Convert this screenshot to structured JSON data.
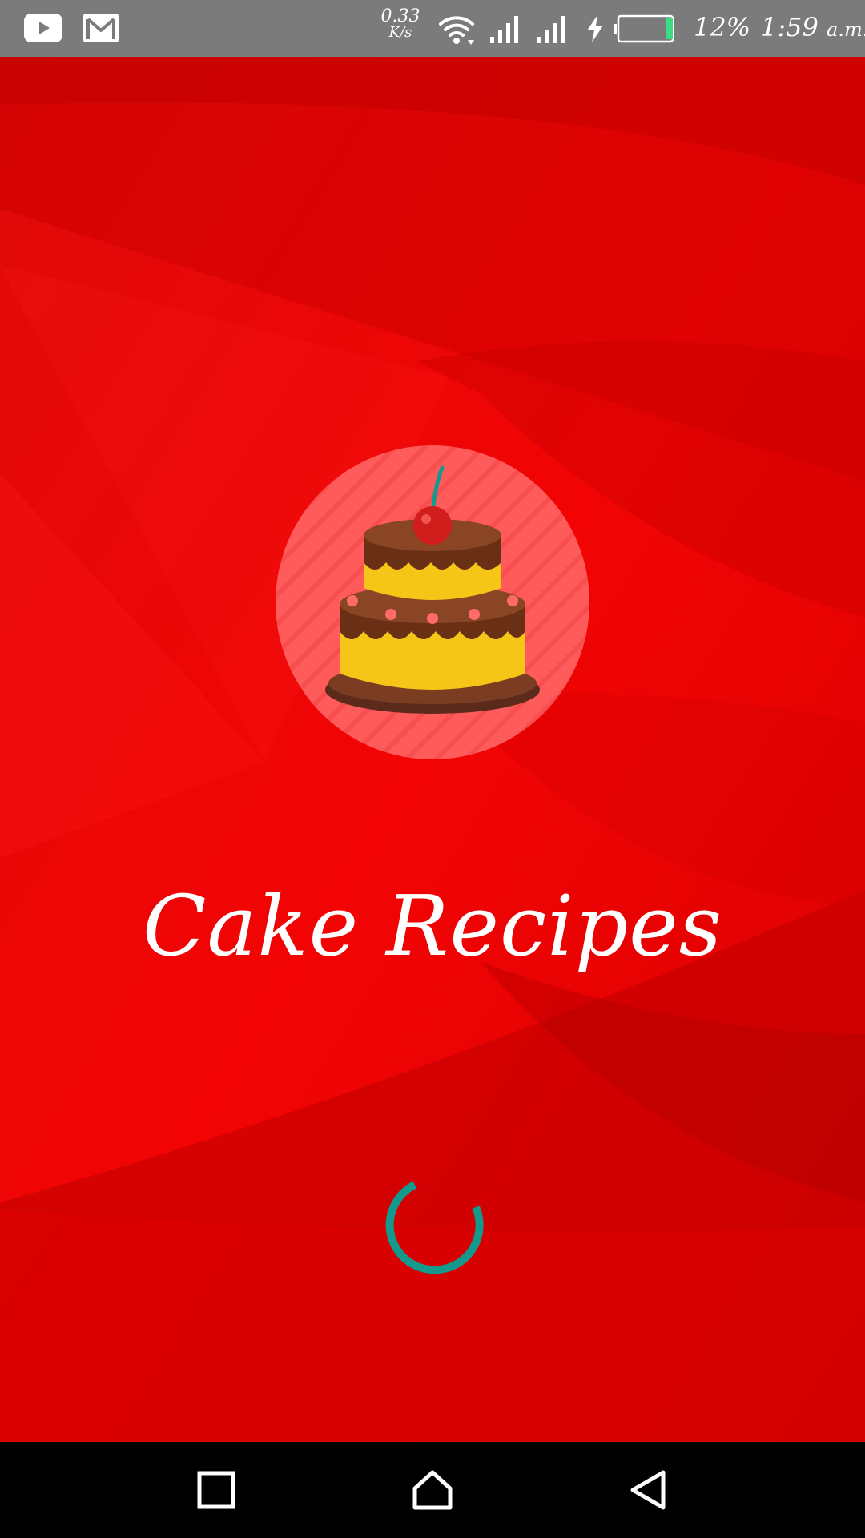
{
  "status_bar": {
    "left_icons": [
      "youtube-icon",
      "gmail-icon"
    ],
    "net_speed_value": "0.33",
    "net_speed_unit": "K/s",
    "right_icons": [
      "wifi-icon",
      "signal-icon",
      "signal-icon",
      "charging-icon",
      "battery-icon"
    ],
    "battery_level": 0.12,
    "battery_percent": "12%",
    "time": "1:59",
    "time_suffix": "a.m."
  },
  "splash": {
    "logo_icon": "cake-icon",
    "title": "Cake Recipes",
    "loading_icon": "loading-spinner-icon"
  },
  "nav_bar": {
    "buttons": [
      "recents-icon",
      "home-icon",
      "back-icon"
    ]
  },
  "colors": {
    "background": "#e60000",
    "status_bar": "#7b7b7b",
    "spinner": "#139a8c",
    "logo_circle": "#ff6b6b",
    "battery_fill": "#3ddc84"
  }
}
